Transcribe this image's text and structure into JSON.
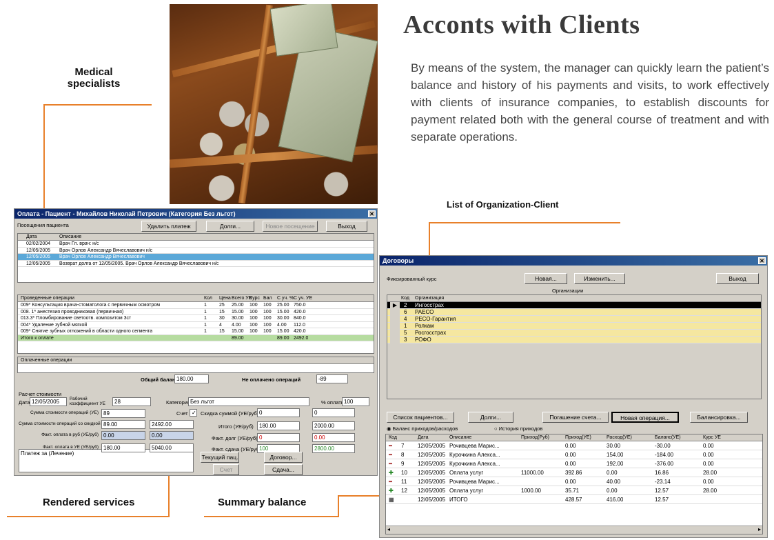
{
  "title": "Acconts with Clients",
  "description": "By means of the system, the manager can quickly learn the patient’s balance and history of his payments and visits, to work effectively with clients of insurance companies, to establish discounts for payment related both with the general course of treatment and with separate operations.",
  "callouts": {
    "medical": "Medical specialists",
    "org": "List of Organization-Client",
    "rendered": "Rendered services",
    "summary": "Summary balance"
  },
  "left_window": {
    "title": "Оплата - Пациент - Михайлов Николай Петрович (Категория Без льгот)",
    "section_label": "Посещения пациента",
    "buttons": [
      "Удалить платеж",
      "Долги...",
      "Новое посещение",
      "Выход"
    ],
    "visits_header": [
      "Дата",
      "Описание"
    ],
    "visits": [
      [
        "02/02/2004",
        "Врач Гл. врач: н/с"
      ],
      [
        "12/05/2005",
        "Врач Орлов Александр Вячеславович н/с"
      ],
      [
        "12/05/2005",
        "Врач Орлов Александр Вячеславович"
      ],
      [
        "12/05/2005",
        "Возврат долга от 12/05/2005. Врач Орлов Александр Вячеславович н/с"
      ]
    ],
    "ops_header": [
      "Проведенные операции",
      "Кол",
      "Цена",
      "Всего УЕ",
      "Курс",
      "Бал",
      "С уч. %",
      "С уч. УЕ"
    ],
    "ops": [
      [
        "009* Консультация врача-стоматолога с первичным осмотром",
        "1",
        "25",
        "25.00",
        "100",
        "100",
        "25.00",
        "750.0"
      ],
      [
        "008. 1* анестезия проводниковая (первичная)",
        "1",
        "15",
        "15.00",
        "100",
        "100",
        "15.00",
        "420.0"
      ],
      [
        "013.3* Пломбирование светоотв. композитом 3ст",
        "1",
        "30",
        "30.00",
        "100",
        "100",
        "30.00",
        "840.0"
      ],
      [
        "004* Удаление зубной мягкой",
        "1",
        "4",
        "4.00",
        "100",
        "100",
        "4.00",
        "112.0"
      ],
      [
        "009* Снятие зубных отложений в области одного сегмента",
        "1",
        "15",
        "15.00",
        "100",
        "100",
        "15.00",
        "420.0"
      ],
      [
        "Итого к оплате",
        "",
        "",
        "89.00",
        "",
        "",
        "89.00",
        "2492.0"
      ]
    ],
    "paid_header": "Оплаченные операции",
    "total_label": "Общий баланс",
    "total_value": "180.00",
    "unpaid_label": "Не оплачено операций",
    "unpaid_value": "-89",
    "calc_label": "Расчет стоимости",
    "date_label": "Дата",
    "date_value": "12/05/2005",
    "rate_label": "Рабочий коэффициент УЕ",
    "rate_value": "28",
    "category_label": "Категория",
    "category_value": "Без льгот",
    "percent_label": "% оплаты",
    "percent_value": "100",
    "sum_rows": [
      [
        "Сумма стоимости операций (УЕ)",
        "89",
        "",
        ""
      ],
      [
        "Сумма стоимости операций со скидкой",
        "89.00",
        "2492.00",
        ""
      ],
      [
        "Факт. оплата в руб (УЕ/руб)",
        "0.00",
        "0.00",
        ""
      ],
      [
        "Факт. оплата в УЕ (УЕ/руб)",
        "180.00",
        "5040.00",
        ""
      ]
    ],
    "check_label": "Счет",
    "discount_label": "Скидка суммой (УЕ/руб)",
    "discount_vals": [
      "0",
      "0"
    ],
    "total2_label": "Итого (УЕ/руб)",
    "total2_vals": [
      "180.00",
      "2000.00"
    ],
    "debt_label": "Факт. долг (УЕ/руб)",
    "debt_vals": [
      "0",
      "0.00"
    ],
    "change_label": "Факт. сдача (УЕ/руб)",
    "change_vals": [
      "100",
      "2800.00"
    ],
    "note_value": "Платеж за (Лечение)",
    "bottom_buttons": [
      "Текущий пац.",
      "Счет",
      "Договор...",
      "Сдача..."
    ]
  },
  "right_window": {
    "title": "Договоры",
    "fixed_rate": "Фиксированный курс",
    "buttons": [
      "Новая...",
      "Изменить...",
      "Выход"
    ],
    "orgs_title": "Организации",
    "orgs_header": [
      "Код",
      "Организация"
    ],
    "orgs": [
      [
        "2",
        "Ингосстрах"
      ],
      [
        "6",
        "РАЕСО"
      ],
      [
        "4",
        "РЕСО-Гарантия"
      ],
      [
        "1",
        "Ролкам"
      ],
      [
        "5",
        "Росгосстрах"
      ],
      [
        "3",
        "РОФО"
      ]
    ],
    "action_buttons": [
      "Список пациентов...",
      "Долги...",
      "Погашение счета...",
      "Новая операция...",
      "Балансировка..."
    ],
    "radio1": "Баланс приходов/расходов",
    "radio2": "История приходов",
    "bal_header": [
      "Код",
      "Дата",
      "Описание",
      "Приход(Руб)",
      "Приход(УЕ)",
      "Расход(УЕ)",
      "Баланс(УЕ)",
      "Курс УЕ"
    ],
    "bal_rows": [
      [
        "7",
        "12/05/2005",
        "Рочивцева Марис...",
        "",
        "0.00",
        "30.00",
        "-30.00",
        "0.00",
        "minus"
      ],
      [
        "8",
        "12/05/2005",
        "Курочкина Алекса...",
        "",
        "0.00",
        "154.00",
        "-184.00",
        "0.00",
        "minus"
      ],
      [
        "9",
        "12/05/2005",
        "Курочкина Алекса...",
        "",
        "0.00",
        "192.00",
        "-376.00",
        "0.00",
        "minus"
      ],
      [
        "10",
        "12/05/2005",
        "Оплата услуг",
        "11000.00",
        "392.86",
        "0.00",
        "16.86",
        "28.00",
        "plus"
      ],
      [
        "11",
        "12/05/2005",
        "Рочивцева Марис...",
        "",
        "0.00",
        "40.00",
        "-23.14",
        "0.00",
        "minus"
      ],
      [
        "12",
        "12/05/2005",
        "Оплата услуг",
        "1000.00",
        "35.71",
        "0.00",
        "12.57",
        "28.00",
        "plus"
      ],
      [
        "",
        "12/05/2005",
        "ИТОГО",
        "",
        "428.57",
        "416.00",
        "12.57",
        "",
        "total"
      ]
    ]
  }
}
